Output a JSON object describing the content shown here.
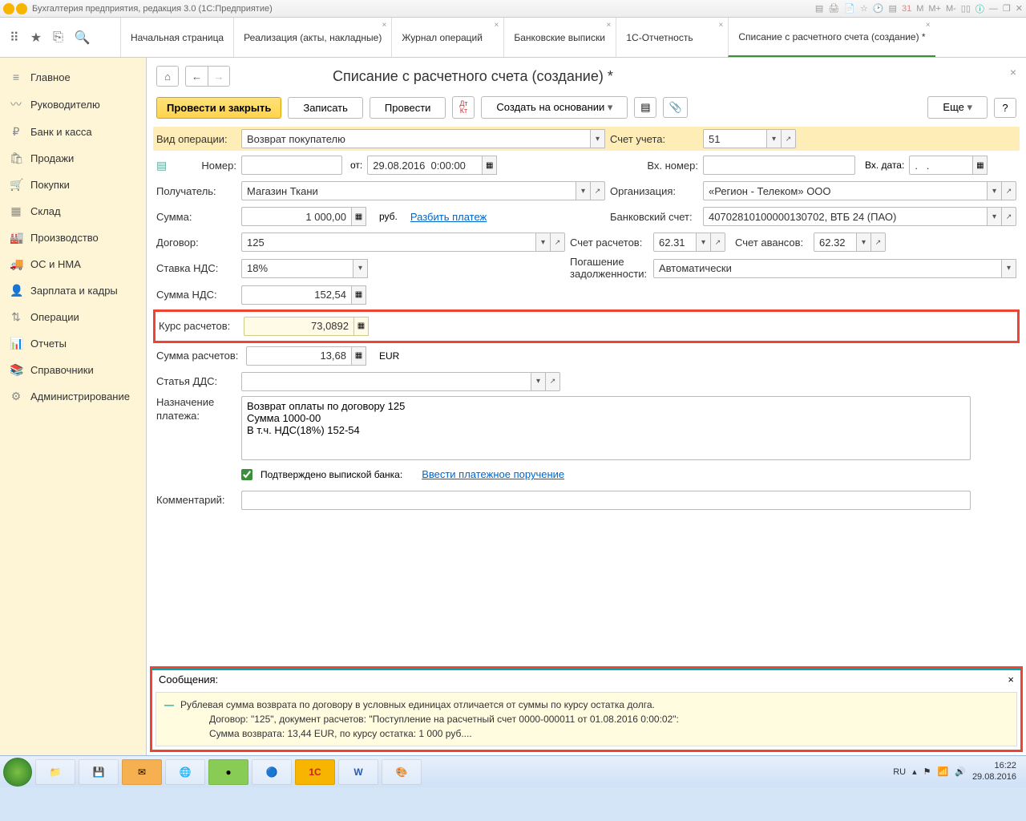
{
  "titlebar": {
    "title": "Бухгалтерия предприятия, редакция 3.0  (1С:Предприятие)",
    "icons": [
      "М",
      "М+",
      "М-"
    ]
  },
  "tabs": [
    {
      "label": "Начальная страница"
    },
    {
      "label": "Реализация (акты, накладные)"
    },
    {
      "label": "Журнал операций"
    },
    {
      "label": "Банковские выписки"
    },
    {
      "label": "1С-Отчетность"
    },
    {
      "label": "Списание с расчетного счета (создание) *"
    }
  ],
  "sidebar": [
    {
      "icon": "≡",
      "label": "Главное"
    },
    {
      "icon": "〰",
      "label": "Руководителю"
    },
    {
      "icon": "₽",
      "label": "Банк и касса"
    },
    {
      "icon": "🛍",
      "label": "Продажи"
    },
    {
      "icon": "🛒",
      "label": "Покупки"
    },
    {
      "icon": "▦",
      "label": "Склад"
    },
    {
      "icon": "🏭",
      "label": "Производство"
    },
    {
      "icon": "🚚",
      "label": "ОС и НМА"
    },
    {
      "icon": "👤",
      "label": "Зарплата и кадры"
    },
    {
      "icon": "⇅",
      "label": "Операции"
    },
    {
      "icon": "📊",
      "label": "Отчеты"
    },
    {
      "icon": "📚",
      "label": "Справочники"
    },
    {
      "icon": "⚙",
      "label": "Администрирование"
    }
  ],
  "page": {
    "title": "Списание с расчетного счета (создание) *",
    "toolbar": {
      "primary": "Провести и закрыть",
      "save": "Записать",
      "post": "Провести",
      "based_on": "Создать на основании",
      "more": "Еще"
    },
    "form": {
      "lbl_optype": "Вид операции:",
      "optype": "Возврат покупателю",
      "lbl_account": "Счет учета:",
      "account": "51",
      "lbl_number": "Номер:",
      "number": "",
      "lbl_from": "от:",
      "date": "29.08.2016  0:00:00",
      "lbl_extnum": "Вх. номер:",
      "extnum": "",
      "lbl_extdate": "Вх. дата:",
      "extdate": ".   .",
      "lbl_recipient": "Получатель:",
      "recipient": "Магазин Ткани",
      "lbl_org": "Организация:",
      "org": "«Регион - Телеком» ООО",
      "lbl_sum": "Сумма:",
      "sum": "1 000,00",
      "rub": "руб.",
      "split": "Разбить платеж",
      "lbl_bankacc": "Банковский счет:",
      "bankacc": "40702810100000130702, ВТБ 24 (ПАО)",
      "lbl_contract": "Договор:",
      "contract": "125",
      "lbl_settle_acc": "Счет расчетов:",
      "settle_acc": "62.31",
      "lbl_adv_acc": "Счет авансов:",
      "adv_acc": "62.32",
      "lbl_vat_rate": "Ставка НДС:",
      "vat_rate": "18%",
      "lbl_debt": "Погашение задолженности:",
      "debt": "Автоматически",
      "lbl_vat_sum": "Сумма НДС:",
      "vat_sum": "152,54",
      "lbl_rate": "Курс расчетов:",
      "rate": "73,0892",
      "lbl_settle_sum": "Сумма расчетов:",
      "settle_sum": "13,68",
      "currency": "EUR",
      "lbl_dds": "Статья ДДС:",
      "dds": "",
      "lbl_purpose": "Назначение платежа:",
      "purpose": "Возврат оплаты по договору 125\nСумма 1000-00\nВ т.ч. НДС(18%) 152-54",
      "confirm": "Подтверждено выпиской банка:",
      "enter_order": "Ввести платежное поручение",
      "lbl_comment": "Комментарий:",
      "comment": ""
    },
    "messages": {
      "title": "Сообщения:",
      "line1": "Рублевая сумма возврата по договору в условных единицах отличается от суммы по курсу остатка долга.",
      "line2": "Договор: \"125\", документ расчетов: \"Поступление на расчетный счет 0000-000011 от 01.08.2016 0:00:02\":",
      "line3": "Сумма возврата: 13,44 EUR, по курсу остатка: 1 000 руб...."
    }
  },
  "taskbar": {
    "lang": "RU",
    "time": "16:22",
    "date": "29.08.2016"
  }
}
